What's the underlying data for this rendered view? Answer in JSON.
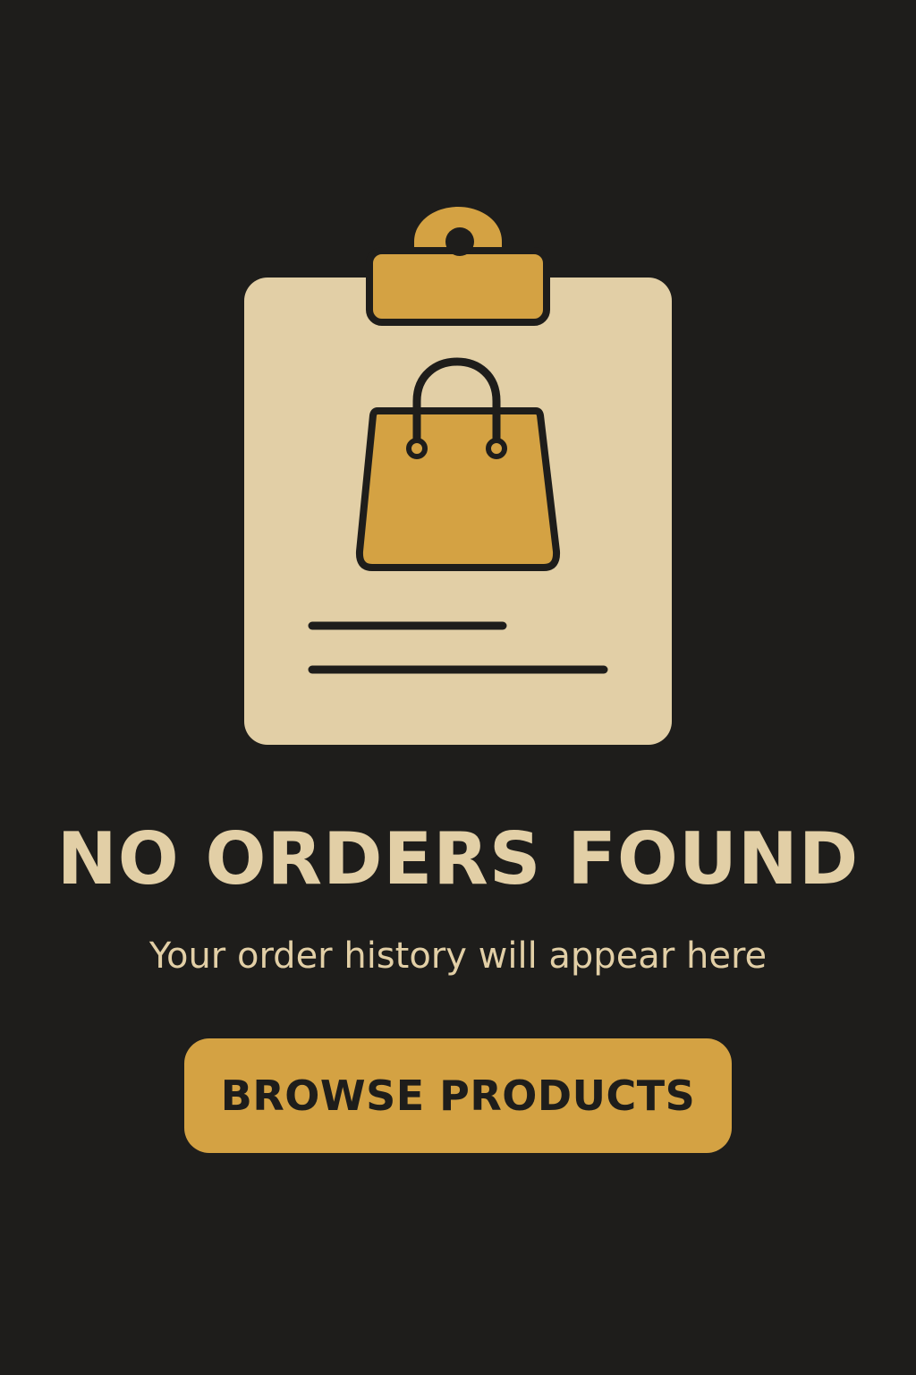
{
  "colors": {
    "background": "#1e1d1b",
    "paper": "#e2cfa6",
    "accent": "#d4a243",
    "ink": "#1e1d1b"
  },
  "illustration": {
    "icons": [
      "clipboard-icon",
      "shopping-bag-icon"
    ]
  },
  "empty_state": {
    "title": "NO ORDERS FOUND",
    "subtitle": "Your order history will appear here",
    "button_label": "BROWSE PRODUCTS"
  }
}
